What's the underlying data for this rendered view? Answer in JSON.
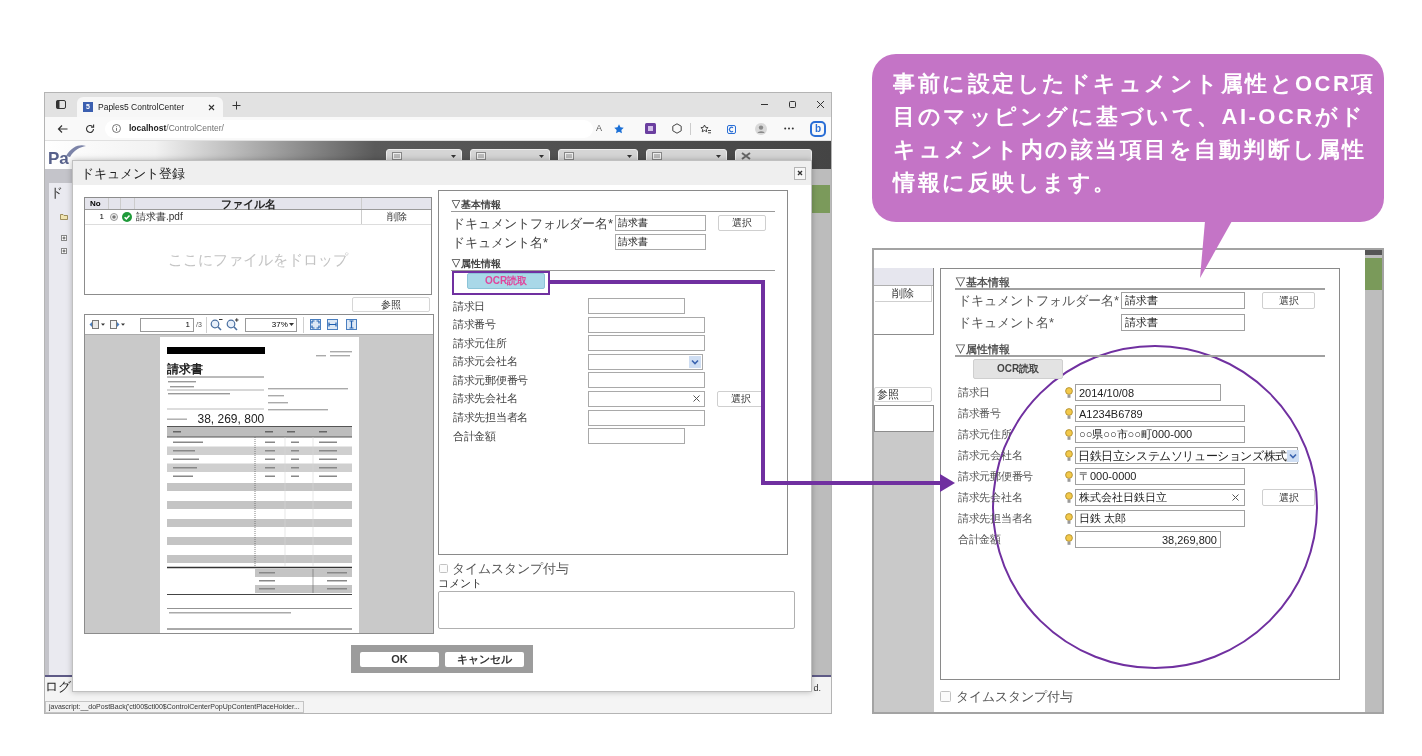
{
  "browser": {
    "tab_title": "Paples5 ControlCenter",
    "favicon_text": "5",
    "url": "**localhost**/ControlCenter/",
    "read_aloud_glyph": "A",
    "copilot_glyph": "b",
    "status_text": "javascript:__doPostBack('ctl00$ctl00$ControlCenterPopUpContentPlaceHolder..."
  },
  "app": {
    "logo_text": "Pa",
    "menu_buttons": [
      {
        "kind": "menu"
      },
      {
        "kind": "menu"
      },
      {
        "kind": "menu"
      },
      {
        "kind": "menu"
      },
      {
        "kind": "logout"
      }
    ],
    "sidebar_text": "ド",
    "footer_left": "ログ",
    "footer_right": "d."
  },
  "dialog": {
    "title": "ドキュメント登録",
    "file_table": {
      "columns": [
        "No",
        "ファイル名"
      ],
      "rows": [
        {
          "no": "1",
          "selected": true,
          "uploaded": true,
          "file_name": "請求書.pdf",
          "delete_button": "削除"
        }
      ],
      "drop_hint": "ここにファイルをドロップ"
    },
    "browse_button": "参照",
    "viewer": {
      "page": "1",
      "page_total": "/3",
      "zoom": "37%",
      "document": {
        "title": "請求書",
        "amount": "38, 269, 800"
      }
    },
    "form": {
      "basic": {
        "heading": "▽基本情報",
        "fields": [
          {
            "label": "ドキュメントフォルダー名*",
            "kind": "text",
            "value": "請求書",
            "button": "選択"
          },
          {
            "label": "ドキュメント名*",
            "kind": "text",
            "value": "請求書"
          }
        ]
      },
      "attributes": {
        "heading": "▽属性情報",
        "ocr_button": {
          "label": "OCR読取",
          "highlighted": true
        },
        "fields": [
          {
            "label": "請求日",
            "kind": "short"
          },
          {
            "label": "請求番号",
            "kind": "text"
          },
          {
            "label": "請求元住所",
            "kind": "text"
          },
          {
            "label": "請求元会社名",
            "kind": "select"
          },
          {
            "label": "請求元郵便番号",
            "kind": "text"
          },
          {
            "label": "請求先会社名",
            "kind": "clearable",
            "button": "選択"
          },
          {
            "label": "請求先担当者名",
            "kind": "text"
          },
          {
            "label": "合計金額",
            "kind": "amount"
          }
        ]
      }
    },
    "timestamp": {
      "label": "タイムスタンプ付与",
      "checked": false
    },
    "comment_label": "コメント",
    "buttons": [
      "OK",
      "キャンセル"
    ]
  },
  "callout": {
    "text": "事前に設定したドキュメント属性とOCR項目のマッピングに基づいて、AI-OCRがドキュメント内の該当項目を自動判断し属性情報に反映します。"
  },
  "zoomed_panel": {
    "delete_button": "削除",
    "browse_button": "参照",
    "form": {
      "basic": {
        "heading": "▽基本情報",
        "fields": [
          {
            "label": "ドキュメントフォルダー名*",
            "kind": "text",
            "value": "請求書",
            "button": "選択"
          },
          {
            "label": "ドキュメント名*",
            "kind": "text",
            "value": "請求書"
          }
        ]
      },
      "attributes": {
        "heading": "▽属性情報",
        "ocr_button": {
          "label": "OCR読取",
          "highlighted": false
        },
        "fields": [
          {
            "label": "請求日",
            "kind": "short",
            "value": "2014/10/08",
            "ocr_mark": true
          },
          {
            "label": "請求番号",
            "kind": "text",
            "value": "A1234B6789",
            "ocr_mark": true
          },
          {
            "label": "請求元住所",
            "kind": "text",
            "value": "○○県○○市○○町000-000",
            "ocr_mark": true
          },
          {
            "label": "請求元会社名",
            "kind": "select",
            "value": "日鉄日立システムソリューションズ株式",
            "ocr_mark": true
          },
          {
            "label": "請求元郵便番号",
            "kind": "text",
            "value": "〒000-0000",
            "ocr_mark": true
          },
          {
            "label": "請求先会社名",
            "kind": "clearable",
            "value": "株式会社日鉄日立",
            "button": "選択",
            "ocr_mark": true
          },
          {
            "label": "請求先担当者名",
            "kind": "text",
            "value": "日鉄 太郎",
            "ocr_mark": true
          },
          {
            "label": "合計金額",
            "kind": "amount",
            "value": "38,269,800",
            "ocr_mark": true
          }
        ]
      }
    },
    "timestamp": {
      "label": "タイムスタンプ付与",
      "checked": false
    }
  }
}
